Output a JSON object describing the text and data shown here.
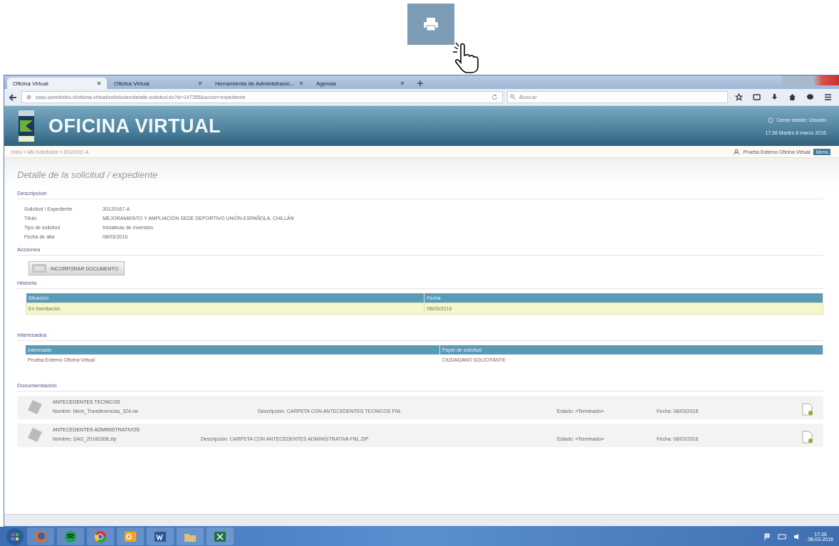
{
  "browser": {
    "tabs": [
      {
        "label": "Oficina Virtual",
        "selected": true
      },
      {
        "label": "Oficina Virtual",
        "selected": false
      },
      {
        "label": "Herramienta de Administració...",
        "selected": false
      },
      {
        "label": "Agenda",
        "selected": false
      }
    ],
    "url": "sago.gorebiobio.cl/oficina-virtual/solicitudes/detalle-solicitud.do?id=147355&accion=expediente",
    "search_placeholder": "Buscar"
  },
  "header": {
    "title": "OFICINA VIRTUAL",
    "user": "Cerrar sesión: Usuario",
    "datetime": "17:36 Martes 8 marzo 2016"
  },
  "breadcrumb": "Inicio » Mis Solicitudes » 30120167-A",
  "account": {
    "name": "Prueba Externo Oficina Virtual",
    "menu": "Menú"
  },
  "page_title": "Detalle de la solicitud / expediente",
  "description": {
    "heading": "Descripción",
    "fields": [
      {
        "label": "Solicitud / Expediente",
        "value": "30120167-A"
      },
      {
        "label": "Título",
        "value": "MEJORAMIENTO Y AMPLIACIÓN SEDE DEPORTIVO UNIÓN ESPAÑOLA, CHILLÁN"
      },
      {
        "label": "Tipo de solicitud",
        "value": "Iniciativas de Inversión"
      },
      {
        "label": "Fecha de alta",
        "value": "08/03/2016"
      }
    ]
  },
  "actions": {
    "heading": "Acciones",
    "buttons": [
      "INCORPORAR DOCUMENTO"
    ]
  },
  "history": {
    "heading": "Historia",
    "columns": [
      "Situación",
      "Fecha"
    ],
    "rows": [
      {
        "cells": [
          "En tramitación",
          "08/03/2016"
        ],
        "selected": true
      }
    ]
  },
  "interested": {
    "heading": "Interesados",
    "columns": [
      "Interesado",
      "Papel de solicitud"
    ],
    "rows": [
      {
        "cells": [
          "Prueba Externo Oficina Virtual",
          "CIUDADANO SOLICITANTE"
        ],
        "selected": false
      }
    ]
  },
  "documents": {
    "heading": "Documentación",
    "items": [
      {
        "title": "ANTECEDENTES TECNICOS",
        "name": "Nombre: Mem_Transferencias_324.rar",
        "description": "Descripción: CARPETA CON ANTECEDENTES TECNICOS FNL",
        "state": "Estado: «Terminado»",
        "date": "Fecha: 08/03/2016"
      },
      {
        "title": "ANTECEDENTES ADMINISTRATIVOS",
        "name": "Nombre: SAG_20160308.zip",
        "description": "Descripción: CARPETA CON ANTECEDENTES ADMINISTRATIVA FNL.ZIP",
        "state": "Estado: «Terminado»",
        "date": "Fecha: 08/03/2016"
      }
    ]
  },
  "taskbar": {
    "time": "17:36",
    "date": "08-03-2016"
  }
}
